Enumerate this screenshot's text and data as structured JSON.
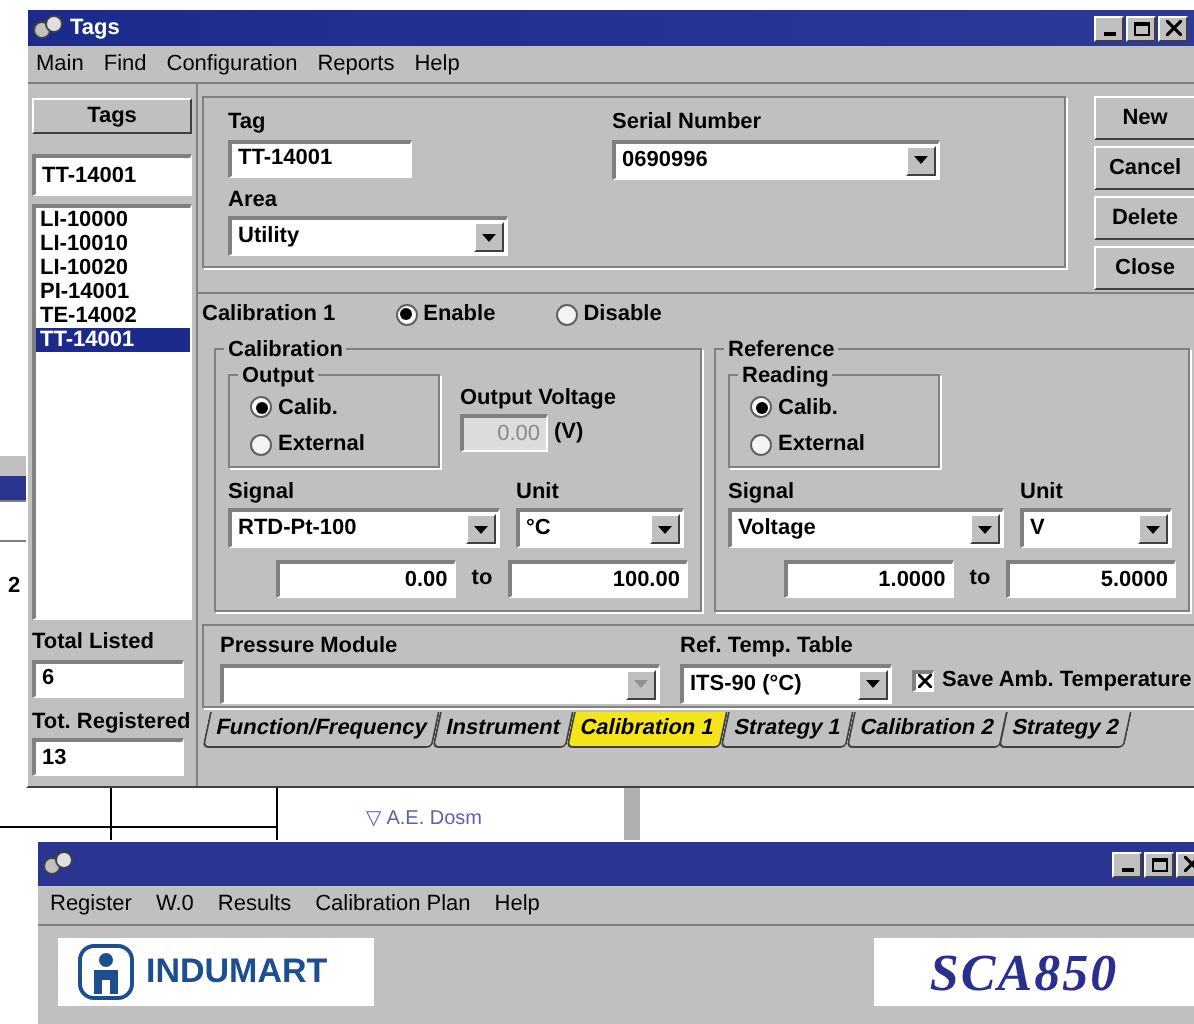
{
  "background": {
    "row_number": "2",
    "diagram_label": "▽ A.E. Dosm"
  },
  "tags_window": {
    "title": "Tags",
    "menu": [
      "Main",
      "Find",
      "Configuration",
      "Reports",
      "Help"
    ],
    "tags_header": "Tags",
    "tag_search": "TT-14001",
    "tag_list": [
      {
        "label": "LI-10000",
        "selected": false
      },
      {
        "label": "LI-10010",
        "selected": false
      },
      {
        "label": "LI-10020",
        "selected": false
      },
      {
        "label": "PI-14001",
        "selected": false
      },
      {
        "label": "TE-14002",
        "selected": false
      },
      {
        "label": "TT-14001",
        "selected": true
      }
    ],
    "total_listed_label": "Total Listed",
    "total_listed": "6",
    "total_registered_label": "Tot. Registered",
    "total_registered": "13",
    "tag_label": "Tag",
    "tag_value": "TT-14001",
    "area_label": "Area",
    "area_value": "Utility",
    "serial_label": "Serial Number",
    "serial_value": "0690996",
    "buttons": [
      "New",
      "Cancel",
      "Delete",
      "Close"
    ],
    "calibration": {
      "title": "Calibration 1",
      "mode": [
        {
          "label": "Enable",
          "selected": true
        },
        {
          "label": "Disable",
          "selected": false
        }
      ],
      "groups": [
        {
          "title": "Calibration",
          "sub_title": "Output",
          "options": [
            {
              "label": "Calib.",
              "selected": true
            },
            {
              "label": "External",
              "selected": false
            }
          ],
          "voltage_label": "Output Voltage",
          "voltage_value": "0.00",
          "voltage_unit": "(V)",
          "signal_label": "Signal",
          "signal": "RTD-Pt-100",
          "unit_label": "Unit",
          "unit": "°C",
          "range_from": "0.00",
          "range_to_label": "to",
          "range_to": "100.00"
        },
        {
          "title": "Reference",
          "sub_title": "Reading",
          "options": [
            {
              "label": "Calib.",
              "selected": true
            },
            {
              "label": "External",
              "selected": false
            }
          ],
          "signal_label": "Signal",
          "signal": "Voltage",
          "unit_label": "Unit",
          "unit": "V",
          "range_from": "1.0000",
          "range_to_label": "to",
          "range_to": "5.0000"
        }
      ]
    },
    "pressure_label": "Pressure Module",
    "pressure_disabled": true,
    "ref_table_label": "Ref. Temp. Table",
    "ref_table": "ITS-90 (°C)",
    "save_amb": {
      "label": "Save Amb. Temperature",
      "checked": true
    },
    "tabs": [
      {
        "label": "Function/Frequency",
        "selected": false
      },
      {
        "label": "Instrument",
        "selected": false
      },
      {
        "label": "Calibration 1",
        "selected": true
      },
      {
        "label": "Strategy 1",
        "selected": false
      },
      {
        "label": "Calibration 2",
        "selected": false
      },
      {
        "label": "Strategy 2",
        "selected": false
      }
    ]
  },
  "register_window": {
    "menu": [
      "Register",
      "W.0",
      "Results",
      "Calibration Plan",
      "Help"
    ],
    "company": "INDUMART",
    "product": "SCA850"
  }
}
